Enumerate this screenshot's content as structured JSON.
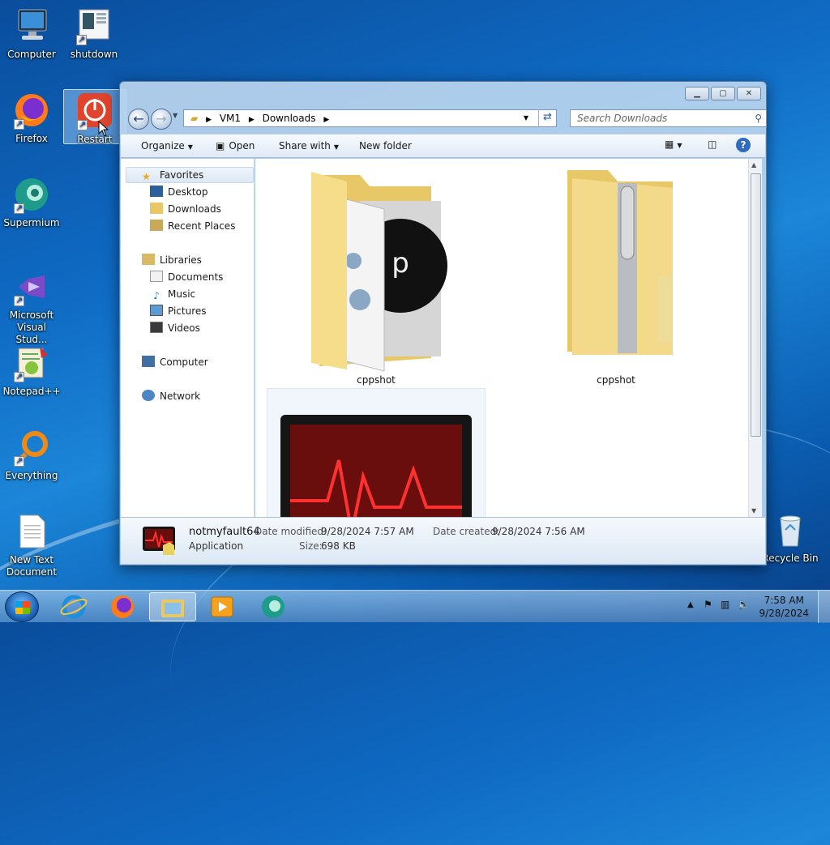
{
  "desktop": {
    "icons": [
      {
        "label": "Computer"
      },
      {
        "label": "shutdown"
      },
      {
        "label": "Firefox"
      },
      {
        "label": "Restart"
      },
      {
        "label": "Supermium"
      },
      {
        "label": "Microsoft Visual Stud..."
      },
      {
        "label": "Notepad++"
      },
      {
        "label": "Everything"
      },
      {
        "label": "New Text Document"
      },
      {
        "label": "Recycle Bin"
      }
    ]
  },
  "explorer": {
    "breadcrumb": [
      "VM1",
      "Downloads"
    ],
    "search_placeholder": "Search Downloads",
    "toolbar": {
      "organize": "Organize",
      "open": "Open",
      "share_with": "Share with",
      "new_folder": "New folder"
    },
    "nav": {
      "favorites": "Favorites",
      "desktop": "Desktop",
      "downloads": "Downloads",
      "recent_places": "Recent Places",
      "libraries": "Libraries",
      "documents": "Documents",
      "music": "Music",
      "pictures": "Pictures",
      "videos": "Videos",
      "computer": "Computer",
      "network": "Network"
    },
    "files": [
      {
        "name": "cppshot",
        "type": "folder"
      },
      {
        "name": "cppshot",
        "type": "zip"
      },
      {
        "name": "notmyfault64",
        "type": "application"
      }
    ],
    "details": {
      "name": "notmyfault64",
      "type": "Application",
      "date_modified_label": "Date modified:",
      "date_modified": "9/28/2024 7:57 AM",
      "date_created_label": "Date created:",
      "date_created": "9/28/2024 7:56 AM",
      "size_label": "Size:",
      "size": "698 KB"
    }
  },
  "taskbar": {
    "time": "7:58 AM",
    "date": "9/28/2024"
  },
  "colors": {
    "accent": "#0f6bc4",
    "selection": "#add8ff",
    "folder": "#f3d37a"
  }
}
